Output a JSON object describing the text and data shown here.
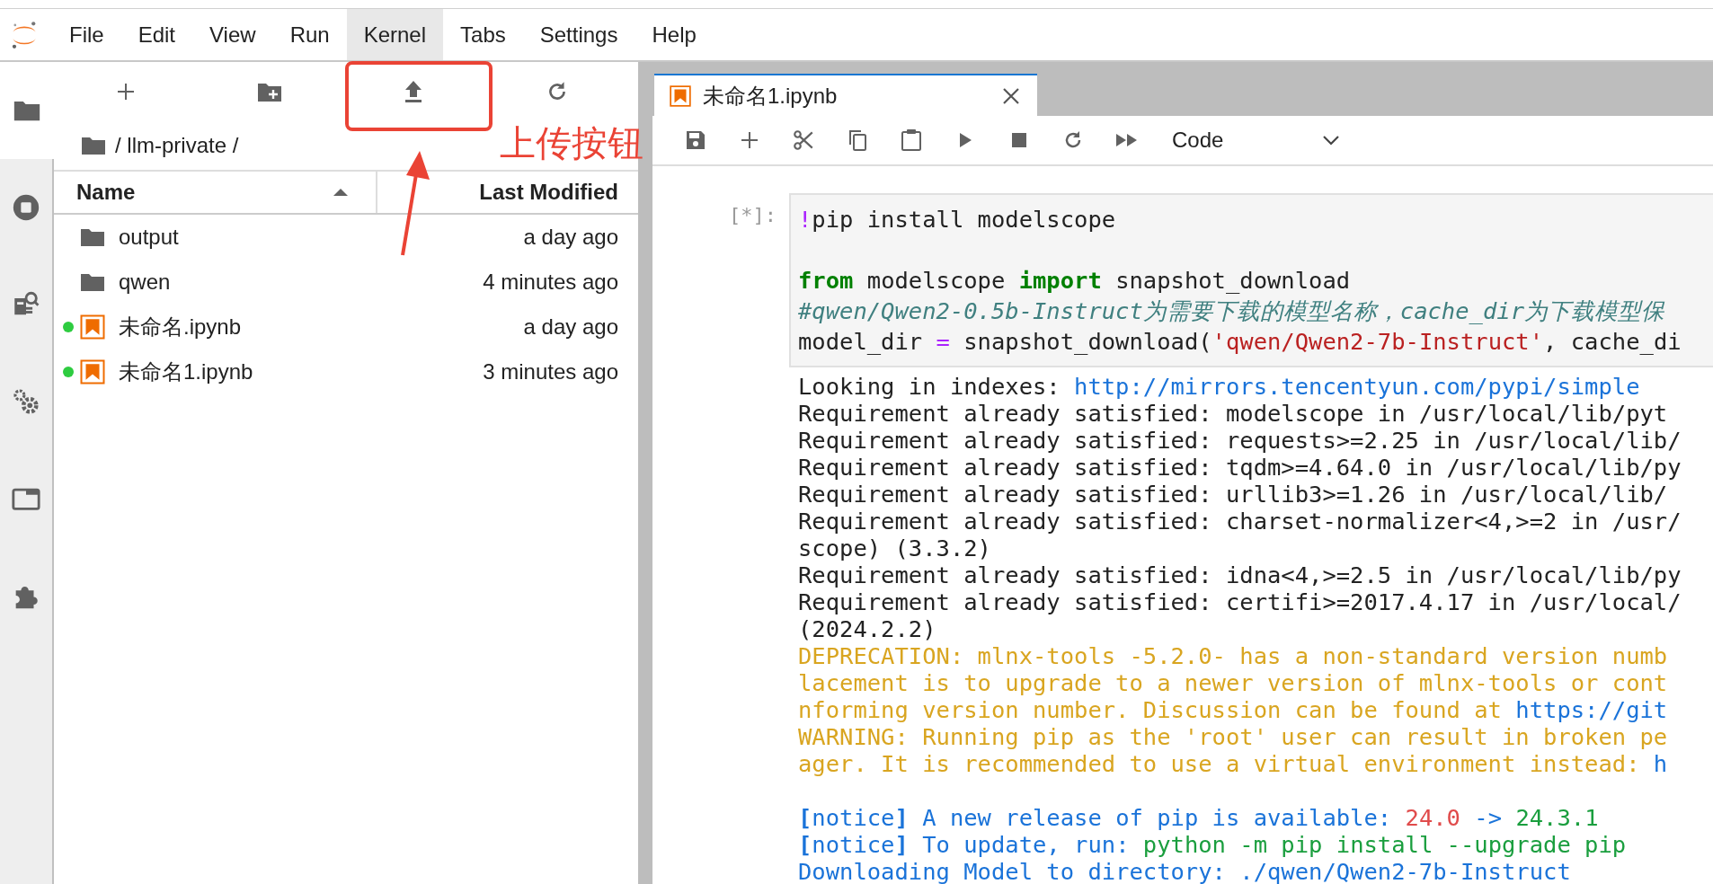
{
  "menu": [
    {
      "label": "File",
      "selected": false
    },
    {
      "label": "Edit",
      "selected": false
    },
    {
      "label": "View",
      "selected": false
    },
    {
      "label": "Run",
      "selected": false
    },
    {
      "label": "Kernel",
      "selected": true
    },
    {
      "label": "Tabs",
      "selected": false
    },
    {
      "label": "Settings",
      "selected": false
    },
    {
      "label": "Help",
      "selected": false
    }
  ],
  "sidebar": [
    {
      "selected": true
    },
    {
      "selected": false
    },
    {
      "selected": false
    },
    {
      "selected": false
    },
    {
      "selected": false
    },
    {
      "selected": false
    }
  ],
  "file_browser": {
    "breadcrumb": "/ llm-private /",
    "columns": [
      {
        "label": "Name",
        "sorted": true
      },
      {
        "label": "Last Modified",
        "sorted": false
      }
    ],
    "rows": [
      {
        "kind": "folder",
        "name": "output",
        "modified": "a day ago",
        "running": false
      },
      {
        "kind": "folder",
        "name": "qwen",
        "modified": "4 minutes ago",
        "running": false
      },
      {
        "kind": "notebook",
        "name": "未命名.ipynb",
        "modified": "a day ago",
        "running": true
      },
      {
        "kind": "notebook",
        "name": "未命名1.ipynb",
        "modified": "3 minutes ago",
        "running": true
      }
    ]
  },
  "annotation": {
    "label": "上传按钮"
  },
  "notebook": {
    "tab": {
      "title": "未命名1.ipynb",
      "selected": true
    },
    "cell_type": "Code",
    "cell": {
      "prompt": "[*]:",
      "code": [
        {
          "blank_before": false,
          "segments": [
            {
              "kind": "magic",
              "text": "!"
            },
            {
              "kind": "plain",
              "text": "pip install modelscope"
            }
          ]
        },
        {
          "blank_before": true,
          "segments": [
            {
              "kind": "keyword",
              "text": "from"
            },
            {
              "kind": "plain",
              "text": " modelscope "
            },
            {
              "kind": "keyword",
              "text": "import"
            },
            {
              "kind": "plain",
              "text": " snapshot_download"
            }
          ]
        },
        {
          "blank_before": false,
          "segments": [
            {
              "kind": "comment",
              "text": "#qwen/Qwen2-0.5b-Instruct为需要下载的模型名称，cache_dir为下载模型保"
            }
          ]
        },
        {
          "blank_before": false,
          "segments": [
            {
              "kind": "plain",
              "text": "model_dir "
            },
            {
              "kind": "op",
              "text": "="
            },
            {
              "kind": "plain",
              "text": " snapshot_download("
            },
            {
              "kind": "string",
              "text": "'qwen/Qwen2-7b-Instruct'"
            },
            {
              "kind": "plain",
              "text": ", cache_di"
            }
          ]
        }
      ],
      "output": [
        {
          "blank_before": false,
          "segments": [
            {
              "kind": "plain",
              "text": "Looking in indexes: "
            },
            {
              "kind": "link",
              "text": "http://mirrors.tencentyun.com/pypi/simple"
            }
          ]
        },
        {
          "blank_before": false,
          "segments": [
            {
              "kind": "plain",
              "text": "Requirement already satisfied: modelscope in /usr/local/lib/pyt"
            }
          ]
        },
        {
          "blank_before": false,
          "segments": [
            {
              "kind": "plain",
              "text": "Requirement already satisfied: requests>=2.25 in /usr/local/lib/"
            }
          ]
        },
        {
          "blank_before": false,
          "segments": [
            {
              "kind": "plain",
              "text": "Requirement already satisfied: tqdm>=4.64.0 in /usr/local/lib/py"
            }
          ]
        },
        {
          "blank_before": false,
          "segments": [
            {
              "kind": "plain",
              "text": "Requirement already satisfied: urllib3>=1.26 in /usr/local/lib/"
            }
          ]
        },
        {
          "blank_before": false,
          "segments": [
            {
              "kind": "plain",
              "text": "Requirement already satisfied: charset-normalizer<4,>=2 in /usr/"
            }
          ]
        },
        {
          "blank_before": false,
          "segments": [
            {
              "kind": "plain",
              "text": "scope) (3.3.2)"
            }
          ]
        },
        {
          "blank_before": false,
          "segments": [
            {
              "kind": "plain",
              "text": "Requirement already satisfied: idna<4,>=2.5 in /usr/local/lib/py"
            }
          ]
        },
        {
          "blank_before": false,
          "segments": [
            {
              "kind": "plain",
              "text": "Requirement already satisfied: certifi>=2017.4.17 in /usr/local/"
            }
          ]
        },
        {
          "blank_before": false,
          "segments": [
            {
              "kind": "plain",
              "text": "(2024.2.2)"
            }
          ]
        },
        {
          "blank_before": false,
          "segments": [
            {
              "kind": "warn",
              "text": "DEPRECATION: mlnx-tools -5.2.0- has a non-standard version numb"
            }
          ]
        },
        {
          "blank_before": false,
          "segments": [
            {
              "kind": "warn",
              "text": "lacement is to upgrade to a newer version of mlnx-tools or cont"
            }
          ]
        },
        {
          "blank_before": false,
          "segments": [
            {
              "kind": "warn",
              "text": "nforming version number. Discussion can be found at "
            },
            {
              "kind": "link",
              "text": "https://git"
            }
          ]
        },
        {
          "blank_before": false,
          "segments": [
            {
              "kind": "warn",
              "text": "WARNING: Running pip as the 'root' user can result in broken pe"
            }
          ]
        },
        {
          "blank_before": false,
          "segments": [
            {
              "kind": "warn",
              "text": "ager. It is recommended to use a virtual environment instead: "
            },
            {
              "kind": "link",
              "text": "h"
            }
          ]
        },
        {
          "blank_before": true,
          "segments": [
            {
              "kind": "bracket",
              "text": "["
            },
            {
              "kind": "link",
              "text": "notice"
            },
            {
              "kind": "bracket",
              "text": "]"
            },
            {
              "kind": "link",
              "text": " A new release of pip is available: "
            },
            {
              "kind": "red",
              "text": "24.0"
            },
            {
              "kind": "link",
              "text": " -> "
            },
            {
              "kind": "green",
              "text": "24.3.1"
            }
          ]
        },
        {
          "blank_before": false,
          "segments": [
            {
              "kind": "bracket",
              "text": "["
            },
            {
              "kind": "link",
              "text": "notice"
            },
            {
              "kind": "bracket",
              "text": "]"
            },
            {
              "kind": "link",
              "text": " To update, run: "
            },
            {
              "kind": "green",
              "text": "python -m pip install --upgrade pip"
            }
          ]
        },
        {
          "blank_before": false,
          "segments": [
            {
              "kind": "link",
              "text": "Downloading Model to directory: ./qwen/Qwen2-7b-Instruct"
            }
          ]
        }
      ]
    }
  }
}
